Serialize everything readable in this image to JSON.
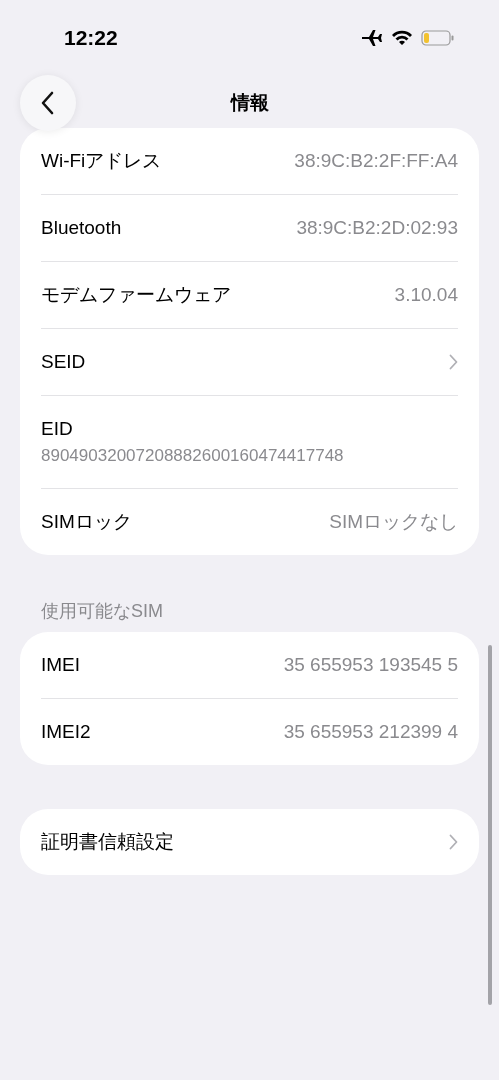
{
  "status_bar": {
    "time": "12:22"
  },
  "nav": {
    "title": "情報"
  },
  "groups": [
    {
      "rows": [
        {
          "kind": "value",
          "label": "Wi-Fiアドレス",
          "value": "38:9C:B2:2F:FF:A4"
        },
        {
          "kind": "value",
          "label": "Bluetooth",
          "value": "38:9C:B2:2D:02:93"
        },
        {
          "kind": "value",
          "label": "モデムファームウェア",
          "value": "3.10.04"
        },
        {
          "kind": "chevron",
          "label": "SEID"
        },
        {
          "kind": "stacked",
          "label": "EID",
          "value": "89049032007208882600160474417748"
        },
        {
          "kind": "value",
          "label": "SIMロック",
          "value": "SIMロックなし"
        }
      ]
    },
    {
      "header": "使用可能なSIM",
      "rows": [
        {
          "kind": "value",
          "label": "IMEI",
          "value": "35 655953 193545 5"
        },
        {
          "kind": "value",
          "label": "IMEI2",
          "value": "35 655953 212399 4"
        }
      ]
    },
    {
      "rows": [
        {
          "kind": "chevron",
          "label": "証明書信頼設定"
        }
      ]
    }
  ]
}
